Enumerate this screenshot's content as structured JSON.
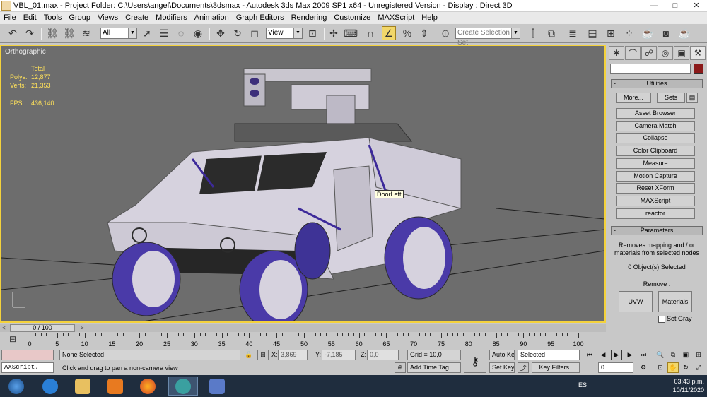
{
  "window": {
    "title": "VBL_01.max     - Project Folder: C:\\Users\\angel\\Documents\\3dsmax      - Autodesk 3ds Max  2009 SP1  x64   - Unregistered Version     - Display : Direct 3D",
    "minimize": "—",
    "maximize": "□",
    "close": "✕"
  },
  "menu": [
    "File",
    "Edit",
    "Tools",
    "Group",
    "Views",
    "Create",
    "Modifiers",
    "Animation",
    "Graph Editors",
    "Rendering",
    "Customize",
    "MAXScript",
    "Help"
  ],
  "toolbar": {
    "selection_filter": "All",
    "reference_coord": "View",
    "named_selection_placeholder": "Create Selection Set",
    "icons": [
      "undo-icon",
      "redo-icon",
      "select-link-icon",
      "unlink-icon",
      "bind-spacewarp-icon",
      "select-object-icon",
      "select-by-name-icon",
      "rect-region-icon",
      "window-crossing-icon",
      "move-icon",
      "rotate-icon",
      "scale-icon",
      "pivot-icon",
      "select-manipulate-icon",
      "keyboard-shortcut-icon",
      "snap-icon",
      "angle-snap-icon",
      "percent-snap-icon",
      "spinner-snap-icon",
      "edit-named-sel-icon",
      "mirror-icon",
      "align-icon",
      "layer-icon",
      "curve-editor-icon",
      "schematic-icon",
      "material-editor-icon",
      "render-setup-icon",
      "render-frame-icon",
      "quick-render-icon"
    ]
  },
  "viewport": {
    "label": "Orthographic",
    "stats": {
      "header": "Total",
      "polys_label": "Polys:",
      "polys": "12,877",
      "verts_label": "Verts:",
      "verts": "21,353",
      "fps_label": "FPS:",
      "fps": "436,140"
    },
    "tooltip": "DoorLeft"
  },
  "command_panel": {
    "tabs": [
      "create-tab-icon",
      "modify-tab-icon",
      "hierarchy-tab-icon",
      "motion-tab-icon",
      "display-tab-icon",
      "utilities-tab-icon"
    ],
    "utilities_rollout": "Utilities",
    "more_button": "More...",
    "sets_button": "Sets",
    "utility_buttons": [
      "Asset Browser",
      "Camera Match",
      "Collapse",
      "Color Clipboard",
      "Measure",
      "Motion Capture",
      "Reset XForm",
      "MAXScript",
      "reactor"
    ],
    "parameters_rollout": "Parameters",
    "description": "Removes mapping and / or materials from selected nodes",
    "selected_count": "0 Object(s) Selected",
    "remove_label": "Remove :",
    "uvw_button": "UVW",
    "materials_button": "Materials",
    "set_gray_label": "Set Gray",
    "rollout_minus": "-"
  },
  "timeline": {
    "slider_label": "0 / 100",
    "ticks": [
      "0",
      "5",
      "10",
      "15",
      "20",
      "25",
      "30",
      "35",
      "40",
      "45",
      "50",
      "55",
      "60",
      "65",
      "70",
      "75",
      "80",
      "85",
      "90",
      "95",
      "100"
    ],
    "arrow_left": "<",
    "arrow_right": ">"
  },
  "status": {
    "selection": "None Selected",
    "prompt": "Click and drag to pan a non-camera view",
    "maxscript_label": "AXScript.",
    "x_label": "X:",
    "x_value": "3,869",
    "y_label": "Y:",
    "y_value": "-7,185",
    "z_label": "Z:",
    "z_value": "0,0",
    "grid": "Grid = 10,0",
    "add_time_tag": "Add Time Tag",
    "auto_key": "Auto Key",
    "set_key": "Set Key",
    "key_mode": "Selected",
    "key_filters": "Key Filters...",
    "frame": "0"
  },
  "taskbar": {
    "apps": [
      "start-orb-icon",
      "ie-icon",
      "explorer-icon",
      "media-icon",
      "firefox-icon",
      "3dsmax-icon",
      "paint-icon"
    ],
    "language": "ES",
    "time": "03:43 p.m.",
    "date": "10/11/2020"
  },
  "colors": {
    "viewport_bg": "#6d6d6d",
    "active_border": "#f4d23c",
    "stats_text": "#ffe15a",
    "taskbar": "#1f2d3e",
    "model_body": "#d6d2de",
    "model_accent": "#3d2a9a"
  }
}
